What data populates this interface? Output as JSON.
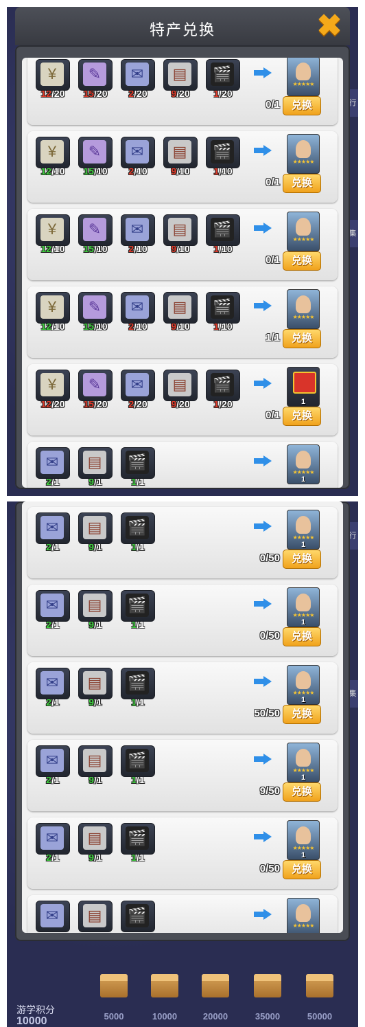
{
  "header": {
    "title": "特产兑换",
    "close_icon": "close-x-icon"
  },
  "colors": {
    "accent_orange": "#f0a21c",
    "need_red": "#e23a2a",
    "have_green": "#3fcf3f",
    "arrow_blue": "#2f8fe8"
  },
  "exchange_label": "兑换",
  "shot1_cards": [
    {
      "mats": [
        {
          "icon": "money-stack-icon",
          "have": "12",
          "need": "/20",
          "ok": false
        },
        {
          "icon": "script-icon",
          "have": "15",
          "need": "/20",
          "ok": false
        },
        {
          "icon": "letter-icon",
          "have": "2",
          "need": "/20",
          "ok": false
        },
        {
          "icon": "ticket-icon",
          "have": "9",
          "need": "/20",
          "ok": false
        },
        {
          "icon": "clapperboard-icon",
          "have": "1",
          "need": "/20",
          "ok": false
        }
      ],
      "reward": "character-card-icon",
      "qty": "",
      "progress": "0/1"
    },
    {
      "mats": [
        {
          "icon": "money-stack-icon",
          "have": "12",
          "need": "/10",
          "ok": true
        },
        {
          "icon": "script-icon",
          "have": "15",
          "need": "/10",
          "ok": true
        },
        {
          "icon": "letter-icon",
          "have": "2",
          "need": "/10",
          "ok": false
        },
        {
          "icon": "ticket-icon",
          "have": "9",
          "need": "/10",
          "ok": false
        },
        {
          "icon": "clapperboard-icon",
          "have": "1",
          "need": "/10",
          "ok": false
        }
      ],
      "reward": "movie-poster-icon",
      "qty": "",
      "progress": "0/1"
    },
    {
      "mats": [
        {
          "icon": "money-stack-icon",
          "have": "12",
          "need": "/10",
          "ok": true
        },
        {
          "icon": "script-icon",
          "have": "15",
          "need": "/10",
          "ok": true
        },
        {
          "icon": "letter-icon",
          "have": "2",
          "need": "/10",
          "ok": false
        },
        {
          "icon": "ticket-icon",
          "have": "9",
          "need": "/10",
          "ok": false
        },
        {
          "icon": "clapperboard-icon",
          "have": "1",
          "need": "/10",
          "ok": false
        }
      ],
      "reward": "horror-poster-icon",
      "qty": "",
      "progress": "0/1"
    },
    {
      "mats": [
        {
          "icon": "money-stack-icon",
          "have": "12",
          "need": "/10",
          "ok": true
        },
        {
          "icon": "script-icon",
          "have": "15",
          "need": "/10",
          "ok": true
        },
        {
          "icon": "letter-icon",
          "have": "2",
          "need": "/10",
          "ok": false
        },
        {
          "icon": "ticket-icon",
          "have": "9",
          "need": "/10",
          "ok": false
        },
        {
          "icon": "clapperboard-icon",
          "have": "1",
          "need": "/10",
          "ok": false
        }
      ],
      "reward": "drama-poster-icon",
      "qty": "",
      "progress": "1/1"
    },
    {
      "mats": [
        {
          "icon": "money-stack-icon",
          "have": "12",
          "need": "/20",
          "ok": false
        },
        {
          "icon": "script-icon",
          "have": "15",
          "need": "/20",
          "ok": false
        },
        {
          "icon": "letter-icon",
          "have": "2",
          "need": "/20",
          "ok": false
        },
        {
          "icon": "ticket-icon",
          "have": "9",
          "need": "/20",
          "ok": false
        },
        {
          "icon": "clapperboard-icon",
          "have": "1",
          "need": "/20",
          "ok": false
        }
      ],
      "reward": "gift-box-icon",
      "qty": "1",
      "progress": "0/1"
    }
  ],
  "shot1_partial": {
    "mats": [
      {
        "icon": "letter-icon",
        "have": "2",
        "need": "/1",
        "ok": true
      },
      {
        "icon": "ticket-icon",
        "have": "9",
        "need": "/1",
        "ok": true
      },
      {
        "icon": "clapperboard-icon",
        "have": "1",
        "need": "/1",
        "ok": true
      }
    ],
    "reward": "actor-card-icon",
    "qty": "1"
  },
  "shot2_cards": [
    {
      "mats": [
        {
          "icon": "letter-icon",
          "have": "2",
          "need": "/1",
          "ok": true
        },
        {
          "icon": "ticket-icon",
          "have": "9",
          "need": "/1",
          "ok": true
        },
        {
          "icon": "clapperboard-icon",
          "have": "1",
          "need": "/1",
          "ok": true
        }
      ],
      "reward": "actor-card-icon",
      "qty": "1",
      "progress": "0/50"
    },
    {
      "mats": [
        {
          "icon": "letter-icon",
          "have": "2",
          "need": "/1",
          "ok": true
        },
        {
          "icon": "ticket-icon",
          "have": "9",
          "need": "/1",
          "ok": true
        },
        {
          "icon": "clapperboard-icon",
          "have": "1",
          "need": "/1",
          "ok": true
        }
      ],
      "reward": "actor-card-icon",
      "qty": "1",
      "progress": "0/50"
    },
    {
      "mats": [
        {
          "icon": "letter-icon",
          "have": "2",
          "need": "/1",
          "ok": true
        },
        {
          "icon": "ticket-icon",
          "have": "9",
          "need": "/1",
          "ok": true
        },
        {
          "icon": "clapperboard-icon",
          "have": "1",
          "need": "/1",
          "ok": true
        }
      ],
      "reward": "actor-card-icon",
      "qty": "1",
      "progress": "50/50"
    },
    {
      "mats": [
        {
          "icon": "letter-icon",
          "have": "2",
          "need": "/1",
          "ok": true
        },
        {
          "icon": "ticket-icon",
          "have": "9",
          "need": "/1",
          "ok": true
        },
        {
          "icon": "clapperboard-icon",
          "have": "1",
          "need": "/1",
          "ok": true
        }
      ],
      "reward": "actor-card-icon",
      "qty": "1",
      "progress": "9/50"
    },
    {
      "mats": [
        {
          "icon": "letter-icon",
          "have": "2",
          "need": "/1",
          "ok": true
        },
        {
          "icon": "ticket-icon",
          "have": "9",
          "need": "/1",
          "ok": true
        },
        {
          "icon": "clapperboard-icon",
          "have": "1",
          "need": "/1",
          "ok": true
        }
      ],
      "reward": "actor-card-icon",
      "qty": "1",
      "progress": "0/50"
    }
  ],
  "shot2_partial": {
    "mats": [
      {
        "icon": "letter-icon"
      },
      {
        "icon": "ticket-icon"
      },
      {
        "icon": "clapperboard-icon"
      }
    ],
    "reward": "actor-card-icon"
  },
  "side_labels": [
    "行",
    "集"
  ],
  "bottom": {
    "score_label": "游学积分",
    "score_value": "10000",
    "chests": [
      {
        "icon": "treasure-chest-icon",
        "value": "5000"
      },
      {
        "icon": "treasure-chest-icon",
        "value": "10000"
      },
      {
        "icon": "treasure-chest-icon",
        "value": "20000"
      },
      {
        "icon": "treasure-chest-icon",
        "value": "35000"
      },
      {
        "icon": "treasure-chest-icon",
        "value": "50000"
      }
    ]
  }
}
